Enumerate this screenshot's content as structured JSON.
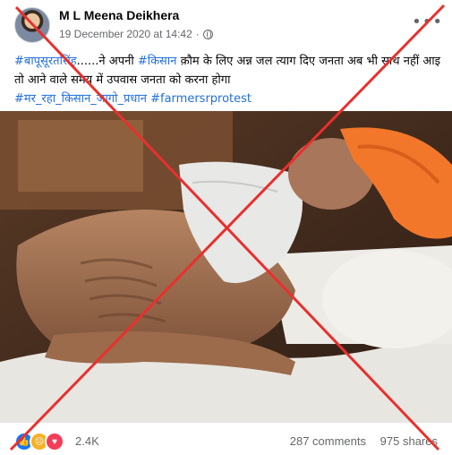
{
  "post": {
    "author": "M L Meena Deikhera",
    "timestamp": "19 December 2020 at 14:42",
    "privacy_icon": "globe-icon",
    "more_icon": "ellipsis-icon",
    "text": {
      "tag1": "#बापूसूरतसिंह",
      "part1": "......ने अपनी ",
      "tag2": "#किसान",
      "part2": " क़ौम के लिए अन्न जल त्याग दिए जनता अब भी साथ नहीं आइ तो आने वाले समय में उपवास जनता को करना होगा",
      "tag3": "#मर_रहा_किसान_जागो_प्रधान",
      "tag4": "#farmersrprotest"
    }
  },
  "image": {
    "subject": "elderly man with white beard and orange turban lying on bed"
  },
  "footer": {
    "reactions": [
      "like-icon",
      "sad-icon",
      "love-icon"
    ],
    "reaction_count": "2.4K",
    "comments": "287 comments",
    "shares": "975 shares"
  },
  "overlay": {
    "cross_color": "#e8302d"
  }
}
